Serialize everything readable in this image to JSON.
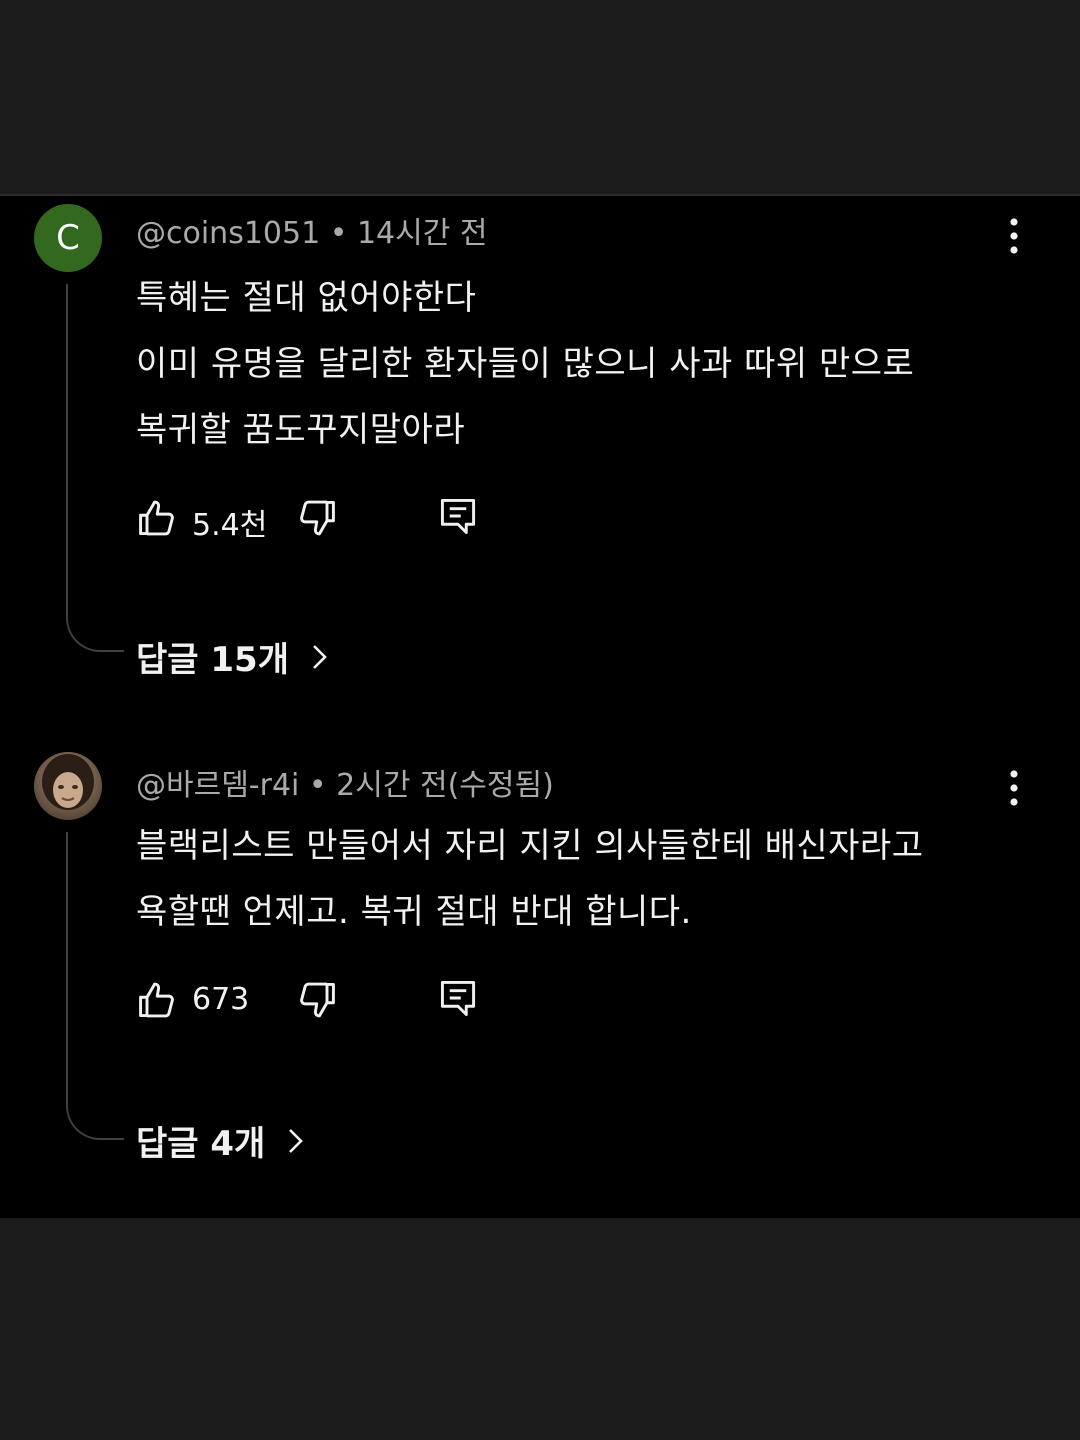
{
  "comments": [
    {
      "avatar_letter": "C",
      "meta": "@coins1051 • 14시간 전",
      "lines": [
        "특혜는 절대 없어야한다",
        "이미 유명을 달리한 환자들이 많으니 사과 따위 만으로",
        "복귀할 꿈도꾸지말아라"
      ],
      "likes": "5.4천",
      "replies_label": "답글 15개"
    },
    {
      "meta": "@바르뎀-r4i • 2시간 전(수정됨)",
      "lines": [
        "블랙리스트 만들어서 자리 지킨 의사들한테 배신자라고",
        "욕할땐 언제고. 복귀 절대 반대 합니다."
      ],
      "likes": "673",
      "replies_label": "답글 4개"
    }
  ],
  "colors": {
    "background": "#000000",
    "outer_band": "#1c1c1c",
    "text": "#f1f1f1",
    "meta_text": "#aaaaaa",
    "avatar_green": "#33691e",
    "thread_line": "#3f3f3f"
  },
  "icons": [
    "more-vert-icon",
    "thumb-up-icon",
    "thumb-down-icon",
    "comment-reply-icon",
    "chevron-right-icon"
  ]
}
